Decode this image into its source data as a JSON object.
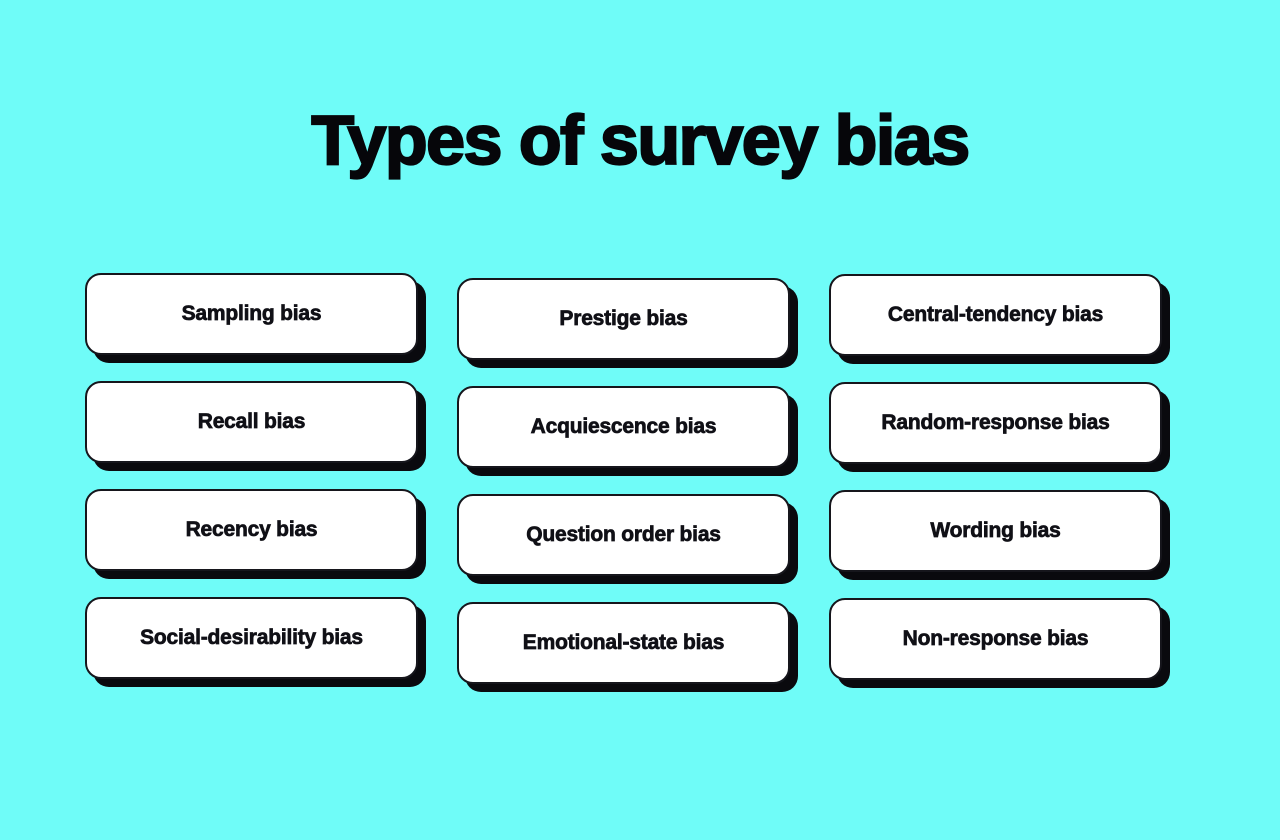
{
  "theme": {
    "background_color": "#6ffcf8",
    "card_background": "#ffffff",
    "card_border_color": "#16161c",
    "card_shadow_color": "#0a0a0e",
    "text_color": "#101016"
  },
  "header": {
    "title": "Types of survey bias"
  },
  "grid": {
    "columns": [
      {
        "name": "column-1",
        "cards": [
          {
            "label": "Sampling bias"
          },
          {
            "label": "Recall bias"
          },
          {
            "label": "Recency bias"
          },
          {
            "label": "Social-desirability bias"
          }
        ]
      },
      {
        "name": "column-2",
        "cards": [
          {
            "label": "Prestige bias"
          },
          {
            "label": "Acquiescence bias"
          },
          {
            "label": "Question order bias"
          },
          {
            "label": "Emotional-state bias"
          }
        ]
      },
      {
        "name": "column-3",
        "cards": [
          {
            "label": "Central-tendency bias"
          },
          {
            "label": "Random-response bias"
          },
          {
            "label": "Wording bias"
          },
          {
            "label": "Non-response bias"
          }
        ]
      }
    ]
  }
}
